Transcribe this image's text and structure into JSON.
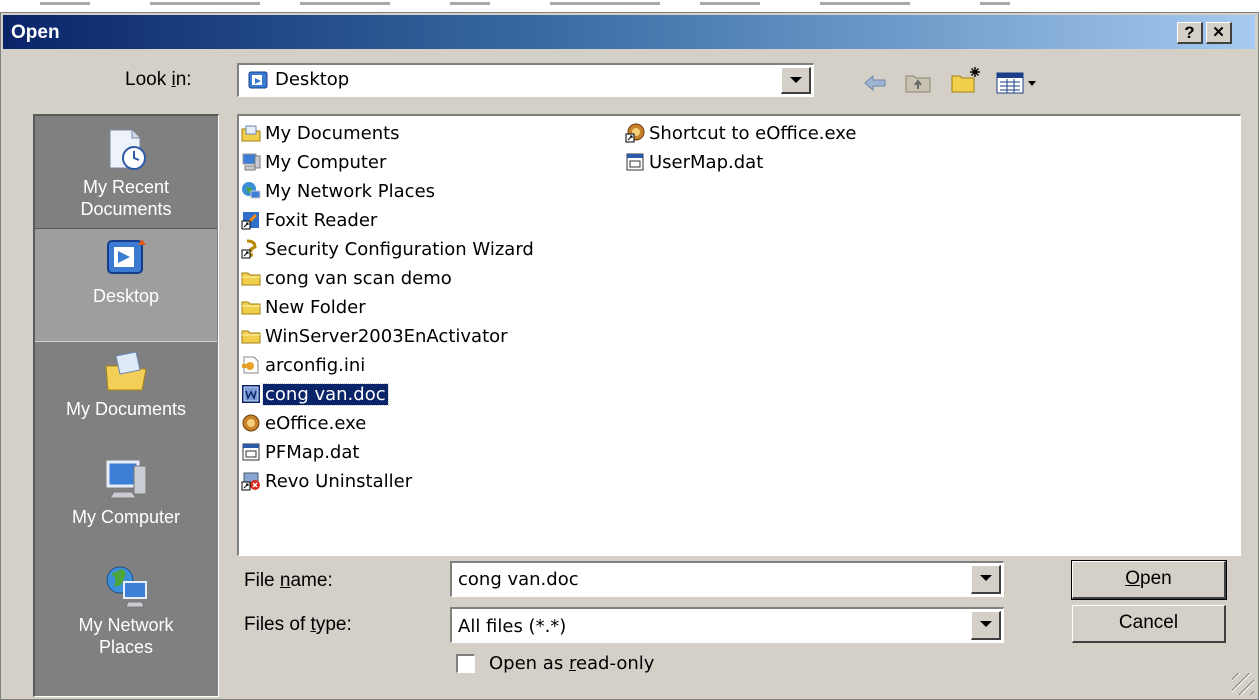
{
  "window": {
    "title": "Open",
    "help_label": "?",
    "close_label": "✕"
  },
  "look_in": {
    "label_pre": "Look ",
    "label_key": "i",
    "label_post": "n:",
    "value": "Desktop"
  },
  "places": [
    {
      "line1": "My Recent",
      "line2": "Documents",
      "icon": "recent-documents-icon"
    },
    {
      "line1": "Desktop",
      "line2": "",
      "icon": "desktop-icon"
    },
    {
      "line1": "My Documents",
      "line2": "",
      "icon": "my-documents-icon"
    },
    {
      "line1": "My Computer",
      "line2": "",
      "icon": "my-computer-icon"
    },
    {
      "line1": "My Network",
      "line2": "Places",
      "icon": "network-places-icon"
    }
  ],
  "files": [
    {
      "name": "My Documents",
      "icon": "folder-docs-icon"
    },
    {
      "name": "My Computer",
      "icon": "computer-icon"
    },
    {
      "name": "My Network Places",
      "icon": "network-icon"
    },
    {
      "name": "Foxit Reader",
      "icon": "shortcut-app-icon"
    },
    {
      "name": "Security Configuration Wizard",
      "icon": "shortcut-wizard-icon"
    },
    {
      "name": "cong van scan demo",
      "icon": "folder-icon"
    },
    {
      "name": "New Folder",
      "icon": "folder-icon"
    },
    {
      "name": "WinServer2003EnActivator",
      "icon": "folder-icon"
    },
    {
      "name": "arconfig.ini",
      "icon": "ini-file-icon"
    },
    {
      "name": "cong van.doc",
      "icon": "word-doc-icon"
    },
    {
      "name": "eOffice.exe",
      "icon": "exe-icon"
    },
    {
      "name": "PFMap.dat",
      "icon": "dat-file-icon"
    },
    {
      "name": "Revo Uninstaller",
      "icon": "shortcut-uninstall-icon"
    },
    {
      "name": "Shortcut to eOffice.exe",
      "icon": "shortcut-exe-icon"
    },
    {
      "name": "UserMap.dat",
      "icon": "dat-file-icon"
    }
  ],
  "selected_file": "cong van.doc",
  "file_name": {
    "label_pre": "File ",
    "label_key": "n",
    "label_post": "ame:",
    "value": "cong van.doc"
  },
  "file_type": {
    "label_pre": "Files of ",
    "label_key": "t",
    "label_post": "ype:",
    "value": "All files (*.*)"
  },
  "readonly": {
    "label_pre": "Open as ",
    "label_key": "r",
    "label_post": "ead-only",
    "checked": false
  },
  "buttons": {
    "open_key": "O",
    "open_rest": "pen",
    "cancel": "Cancel"
  },
  "colors": {
    "title_start": "#0a246a",
    "title_end": "#a6caf0",
    "selection": "#0a246a",
    "face": "#d4d0c8"
  }
}
